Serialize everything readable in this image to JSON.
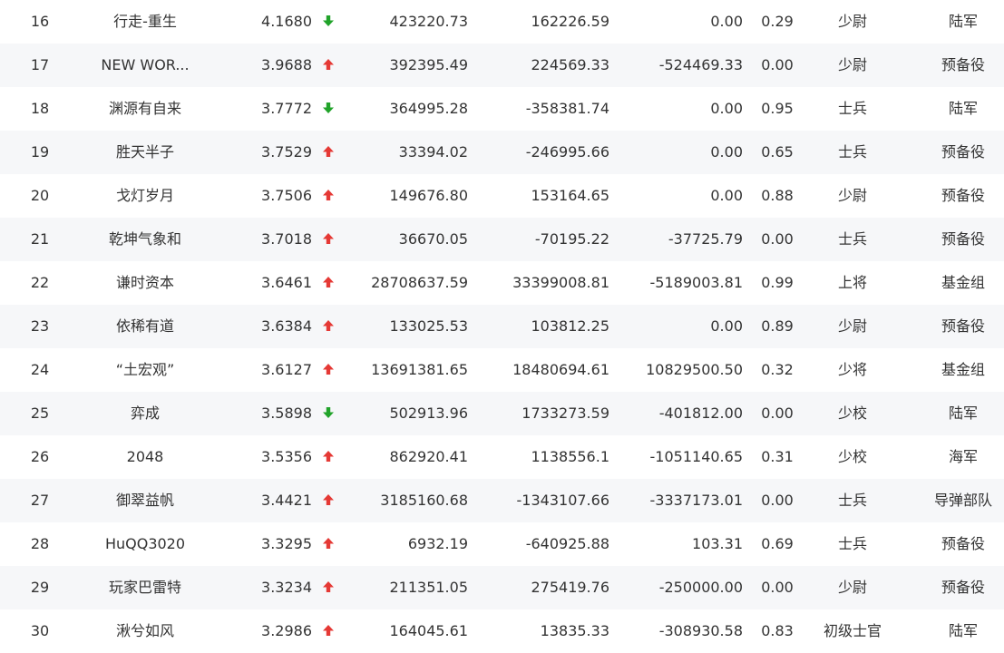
{
  "colors": {
    "up": "#e53935",
    "down": "#21a32a",
    "text": "#333333",
    "stripe": "#f6f7f9"
  },
  "rows": [
    {
      "rank": "16",
      "name": "行走-重生",
      "score": "4.1680",
      "trend": "down",
      "v1": "423220.73",
      "v2": "162226.59",
      "v3": "0.00",
      "ratio": "0.29",
      "rank_name": "少尉",
      "army": "陆军"
    },
    {
      "rank": "17",
      "name": "NEW WOR...",
      "score": "3.9688",
      "trend": "up",
      "v1": "392395.49",
      "v2": "224569.33",
      "v3": "-524469.33",
      "ratio": "0.00",
      "rank_name": "少尉",
      "army": "预备役"
    },
    {
      "rank": "18",
      "name": "渊源有自来",
      "score": "3.7772",
      "trend": "down",
      "v1": "364995.28",
      "v2": "-358381.74",
      "v3": "0.00",
      "ratio": "0.95",
      "rank_name": "士兵",
      "army": "陆军"
    },
    {
      "rank": "19",
      "name": "胜天半子",
      "score": "3.7529",
      "trend": "up",
      "v1": "33394.02",
      "v2": "-246995.66",
      "v3": "0.00",
      "ratio": "0.65",
      "rank_name": "士兵",
      "army": "预备役"
    },
    {
      "rank": "20",
      "name": "戈灯岁月",
      "score": "3.7506",
      "trend": "up",
      "v1": "149676.80",
      "v2": "153164.65",
      "v3": "0.00",
      "ratio": "0.88",
      "rank_name": "少尉",
      "army": "预备役"
    },
    {
      "rank": "21",
      "name": "乾坤气象和",
      "score": "3.7018",
      "trend": "up",
      "v1": "36670.05",
      "v2": "-70195.22",
      "v3": "-37725.79",
      "ratio": "0.00",
      "rank_name": "士兵",
      "army": "预备役"
    },
    {
      "rank": "22",
      "name": "谦时资本",
      "score": "3.6461",
      "trend": "up",
      "v1": "28708637.59",
      "v2": "33399008.81",
      "v3": "-5189003.81",
      "ratio": "0.99",
      "rank_name": "上将",
      "army": "基金组"
    },
    {
      "rank": "23",
      "name": "依稀有道",
      "score": "3.6384",
      "trend": "up",
      "v1": "133025.53",
      "v2": "103812.25",
      "v3": "0.00",
      "ratio": "0.89",
      "rank_name": "少尉",
      "army": "预备役"
    },
    {
      "rank": "24",
      "name": "“土宏观”",
      "score": "3.6127",
      "trend": "up",
      "v1": "13691381.65",
      "v2": "18480694.61",
      "v3": "10829500.50",
      "ratio": "0.32",
      "rank_name": "少将",
      "army": "基金组"
    },
    {
      "rank": "25",
      "name": "弈成",
      "score": "3.5898",
      "trend": "down",
      "v1": "502913.96",
      "v2": "1733273.59",
      "v3": "-401812.00",
      "ratio": "0.00",
      "rank_name": "少校",
      "army": "陆军"
    },
    {
      "rank": "26",
      "name": "2048",
      "score": "3.5356",
      "trend": "up",
      "v1": "862920.41",
      "v2": "1138556.1",
      "v3": "-1051140.65",
      "ratio": "0.31",
      "rank_name": "少校",
      "army": "海军"
    },
    {
      "rank": "27",
      "name": "御翠益帆",
      "score": "3.4421",
      "trend": "up",
      "v1": "3185160.68",
      "v2": "-1343107.66",
      "v3": "-3337173.01",
      "ratio": "0.00",
      "rank_name": "士兵",
      "army": "导弹部队"
    },
    {
      "rank": "28",
      "name": "HuQQ3020",
      "score": "3.3295",
      "trend": "up",
      "v1": "6932.19",
      "v2": "-640925.88",
      "v3": "103.31",
      "ratio": "0.69",
      "rank_name": "士兵",
      "army": "预备役"
    },
    {
      "rank": "29",
      "name": "玩家巴雷特",
      "score": "3.3234",
      "trend": "up",
      "v1": "211351.05",
      "v2": "275419.76",
      "v3": "-250000.00",
      "ratio": "0.00",
      "rank_name": "少尉",
      "army": "预备役"
    },
    {
      "rank": "30",
      "name": "湫兮如风",
      "score": "3.2986",
      "trend": "up",
      "v1": "164045.61",
      "v2": "13835.33",
      "v3": "-308930.58",
      "ratio": "0.83",
      "rank_name": "初级士官",
      "army": "陆军"
    }
  ]
}
